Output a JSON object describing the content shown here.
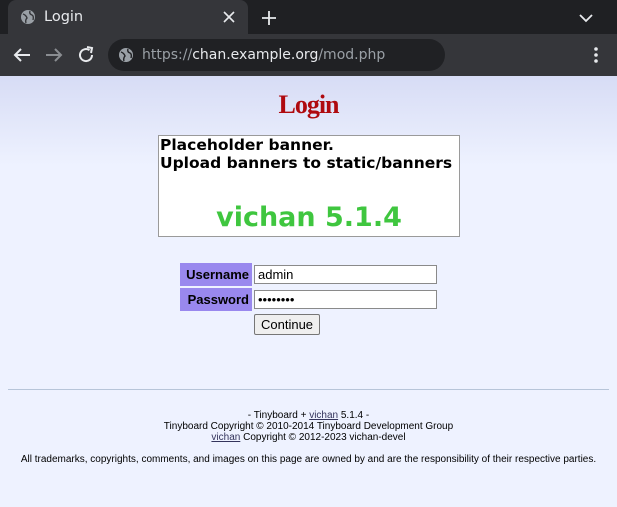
{
  "browser": {
    "tab_title": "Login",
    "url_scheme": "https://",
    "url_host": "chan.example.org",
    "url_path": "/mod.php",
    "colors": {
      "tabbar": "#1f2023",
      "toolbar": "#35363a",
      "omnibox": "#202124"
    }
  },
  "page": {
    "heading": "Login",
    "banner": {
      "line1": "Placeholder banner.",
      "line2": "Upload banners to static/banners",
      "version": "vichan 5.1.4"
    },
    "form": {
      "username_label": "Username",
      "username_value": "admin",
      "password_label": "Password",
      "password_value": "••••••••",
      "continue_label": "Continue"
    },
    "footer": {
      "line1_prefix": "- Tinyboard + ",
      "line1_link": "vichan",
      "line1_suffix": " 5.1.4 -",
      "line2": "Tinyboard Copyright © 2010-2014 Tinyboard Development Group",
      "line3_link": "vichan",
      "line3_suffix": " Copyright © 2012-2023 vichan-devel",
      "line4": "All trademarks, copyrights, comments, and images on this page are owned by and are the responsibility of their respective parties."
    },
    "colors": {
      "heading": "#af0a0f",
      "label_bg": "#9988ee",
      "version": "#3fc63f",
      "background": "#eef2ff"
    }
  }
}
